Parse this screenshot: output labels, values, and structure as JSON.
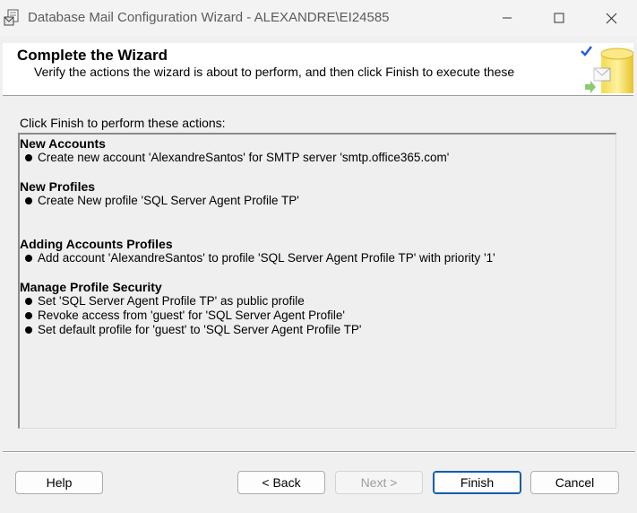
{
  "window": {
    "title": "Database Mail Configuration Wizard - ALEXANDRE\\EI24585",
    "controls": [
      "minimize-icon",
      "maximize-icon",
      "close-icon"
    ]
  },
  "header": {
    "title": "Complete the Wizard",
    "subtitle": "Verify the actions the wizard is about to perform, and then click Finish to execute these"
  },
  "body": {
    "intro": "Click Finish to perform these actions:",
    "sections": [
      {
        "heading": "New Accounts",
        "items": [
          "Create new account 'AlexandreSantos' for SMTP server 'smtp.office365.com'"
        ]
      },
      {
        "heading": "New Profiles",
        "items": [
          "Create New profile 'SQL Server Agent Profile TP'"
        ]
      },
      {
        "heading": "Adding Accounts Profiles",
        "items": [
          "Add account 'AlexandreSantos' to profile 'SQL Server Agent Profile TP' with priority '1'"
        ]
      },
      {
        "heading": "Manage Profile Security",
        "items": [
          "Set 'SQL Server Agent Profile TP' as public profile",
          "Revoke access from 'guest' for 'SQL Server Agent Profile'",
          "Set default profile for 'guest' to 'SQL Server Agent Profile TP'"
        ]
      }
    ]
  },
  "buttons": {
    "help": "Help",
    "back": "< Back",
    "next": "Next >",
    "finish": "Finish",
    "cancel": "Cancel"
  },
  "colors": {
    "accent": "#0c5da8",
    "disabled_text": "#9d9d9d",
    "checkmark": "#2a5bd7"
  }
}
